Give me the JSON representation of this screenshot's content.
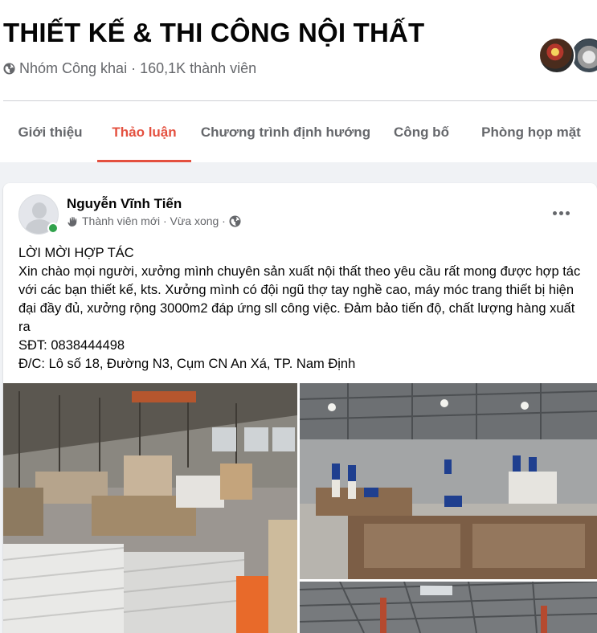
{
  "group": {
    "title": "THIẾT KẾ & THI CÔNG NỘI THẤT",
    "meta": "Nhóm Công khai · 160,1K thành viên"
  },
  "tabs": [
    {
      "label": "Giới thiệu",
      "active": false
    },
    {
      "label": "Thảo luận",
      "active": true
    },
    {
      "label": "Chương trình định hướng",
      "active": false
    },
    {
      "label": "Công bố",
      "active": false
    },
    {
      "label": "Phòng họp mặt",
      "active": false
    }
  ],
  "post": {
    "author": "Nguyễn Vĩnh Tiến",
    "meta": "Thành viên mới · Vừa xong ·",
    "lines": [
      "LỜI MỜI HỢP TÁC",
      "Xin chào mọi người, xưởng mình chuyên sản xuất nội thất theo yêu cầu rất mong được hợp tác với các bạn thiết kế, kts. Xưởng mình có đội ngũ thợ tay nghề cao, máy móc trang thiết bị hiện đại đầy đủ, xưởng rộng 3000m2 đáp ứng sll công việc. Đảm bảo tiến độ, chất lượng hàng xuất ra",
      "SĐT: 0838444498",
      "Đ/C:  Lô số 18, Đường N3, Cụm CN An Xá, TP. Nam Định"
    ]
  },
  "colors": {
    "accent": "#e4503f",
    "secondary_text": "#65676b",
    "feed_background": "#f0f2f5",
    "online": "#31a24c"
  },
  "icons": {
    "privacy": "globe-icon",
    "new_member": "wave-hand-icon",
    "audience": "globe-icon",
    "options": "more-horizontal-icon"
  }
}
